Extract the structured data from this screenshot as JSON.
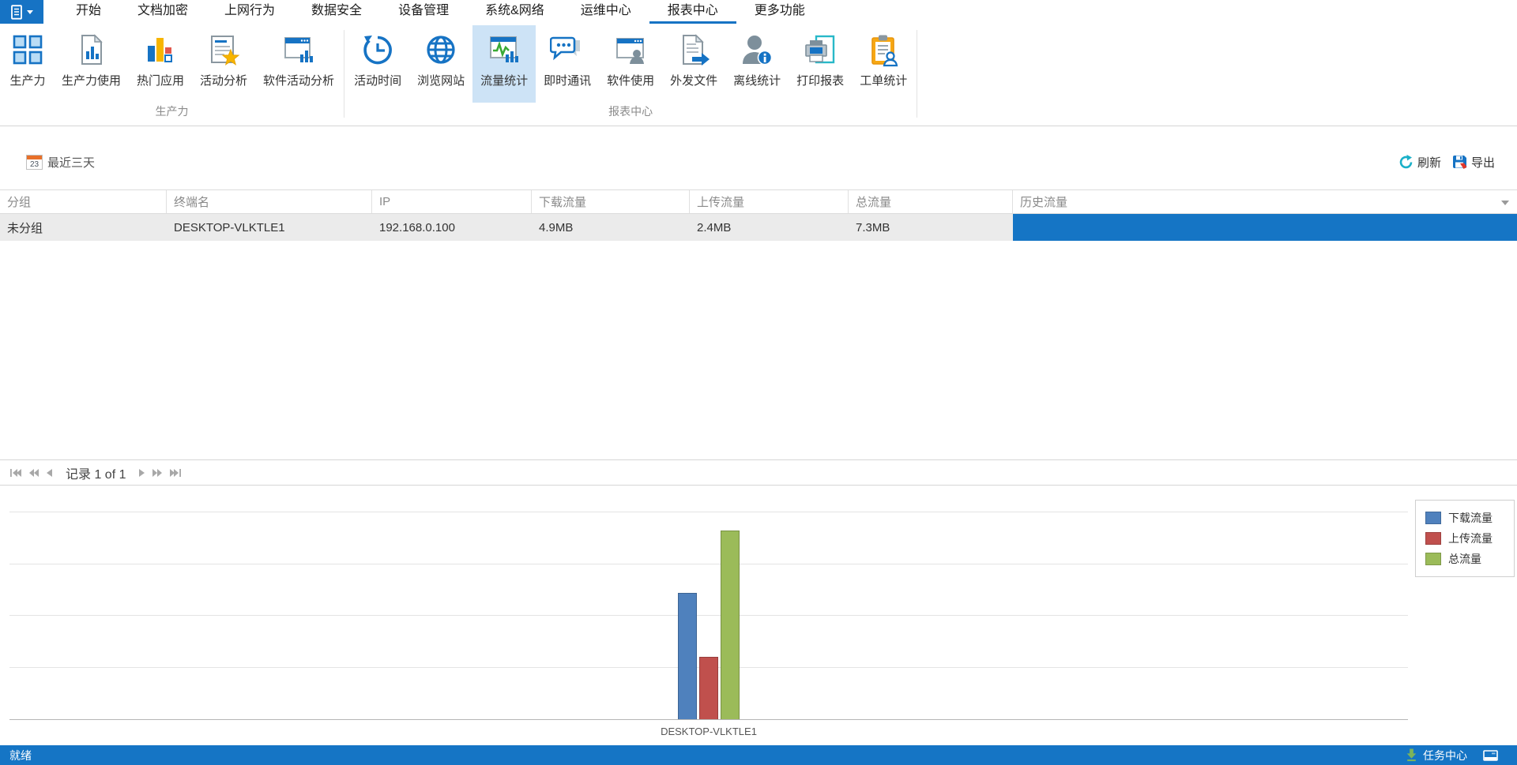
{
  "app": {
    "tabs": [
      {
        "label": "开始",
        "active": false
      },
      {
        "label": "文档加密",
        "active": false
      },
      {
        "label": "上网行为",
        "active": false
      },
      {
        "label": "数据安全",
        "active": false
      },
      {
        "label": "设备管理",
        "active": false
      },
      {
        "label": "系统&网络",
        "active": false
      },
      {
        "label": "运维中心",
        "active": false
      },
      {
        "label": "报表中心",
        "active": true
      },
      {
        "label": "更多功能",
        "active": false
      }
    ]
  },
  "ribbon": {
    "groups": [
      {
        "label": "生产力",
        "buttons": [
          {
            "label": "生产力",
            "icon": "grid-icon",
            "active": false
          },
          {
            "label": "生产力使用",
            "icon": "doc-chart-icon",
            "active": false
          },
          {
            "label": "热门应用",
            "icon": "top-apps-icon",
            "active": false
          },
          {
            "label": "活动分析",
            "icon": "doc-star-icon",
            "active": false
          },
          {
            "label": "软件活动分析",
            "icon": "window-chart-icon",
            "active": false
          }
        ]
      },
      {
        "label": "报表中心",
        "buttons": [
          {
            "label": "活动时间",
            "icon": "history-clock-icon",
            "active": false
          },
          {
            "label": "浏览网站",
            "icon": "globe-icon",
            "active": false
          },
          {
            "label": "流量统计",
            "icon": "traffic-stats-icon",
            "active": true
          },
          {
            "label": "即时通讯",
            "icon": "chat-icon",
            "active": false
          },
          {
            "label": "软件使用",
            "icon": "window-user-icon",
            "active": false
          },
          {
            "label": "外发文件",
            "icon": "doc-arrow-icon",
            "active": false
          },
          {
            "label": "离线统计",
            "icon": "user-info-icon",
            "active": false
          },
          {
            "label": "打印报表",
            "icon": "printer-icon",
            "active": false
          },
          {
            "label": "工单统计",
            "icon": "clipboard-user-icon",
            "active": false
          }
        ]
      }
    ]
  },
  "toolbar": {
    "date_filter": "最近三天",
    "calendar_day": "23",
    "refresh": "刷新",
    "export": "导出"
  },
  "table": {
    "columns": [
      "分组",
      "终端名",
      "IP",
      "下载流量",
      "上传流量",
      "总流量",
      "历史流量"
    ],
    "rows": [
      {
        "group": "未分组",
        "terminal": "DESKTOP-VLKTLE1",
        "ip": "192.168.0.100",
        "download": "4.9MB",
        "upload": "2.4MB",
        "total": "7.3MB",
        "history": ""
      }
    ]
  },
  "pagination": {
    "label": "记录 1 of 1"
  },
  "chart_data": {
    "type": "bar",
    "title": "",
    "xlabel": "",
    "ylabel": "",
    "unit": "MB",
    "categories": [
      "DESKTOP-VLKTLE1"
    ],
    "series": [
      {
        "name": "下载流量",
        "values": [
          4.9
        ],
        "color": "#4F81BD"
      },
      {
        "name": "上传流量",
        "values": [
          2.4
        ],
        "color": "#C0504D"
      },
      {
        "name": "总流量",
        "values": [
          7.3
        ],
        "color": "#9BBB59"
      }
    ],
    "ylim": [
      0,
      8
    ],
    "grid": true,
    "gridline_step": 2,
    "legend_position": "top-right"
  },
  "status_bar": {
    "ready": "就绪",
    "task_center": "任务中心"
  },
  "colors": {
    "accent_blue": "#1673C4",
    "ribbon_highlight": "#CDE3F6",
    "selected_cell_blue": "#1575C5",
    "selected_row_gray": "#EBEBEB",
    "statusbar_blue": "#1575C5"
  }
}
